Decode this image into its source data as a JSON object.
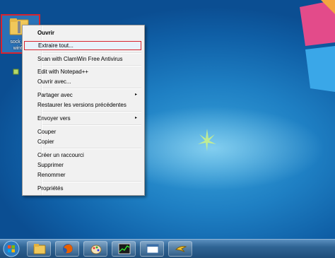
{
  "desktop": {
    "icon_label_line1": "sock_ass",
    "icon_label_line2": "win64-"
  },
  "context_menu": {
    "items": [
      {
        "label": "Ouvrir"
      },
      {
        "label": "Extraire tout..."
      },
      {
        "label": "Scan with ClamWin Free Antivirus"
      },
      {
        "label": "Edit with Notepad++"
      },
      {
        "label": "Ouvrir avec..."
      },
      {
        "label": "Partager avec"
      },
      {
        "label": "Restaurer les versions précédentes"
      },
      {
        "label": "Envoyer vers"
      },
      {
        "label": "Couper"
      },
      {
        "label": "Copier"
      },
      {
        "label": "Créer un raccourci"
      },
      {
        "label": "Supprimer"
      },
      {
        "label": "Renommer"
      },
      {
        "label": "Propriétés"
      }
    ],
    "submenu_arrow": "▸"
  },
  "taskbar": {
    "buttons": [
      "windows-explorer-icon",
      "firefox-icon",
      "paint-icon",
      "task-manager-icon",
      "window-icon",
      "bird-icon"
    ]
  },
  "colors": {
    "highlight_border": "#d9232e",
    "desktop_blue": "#1e7fc3"
  }
}
